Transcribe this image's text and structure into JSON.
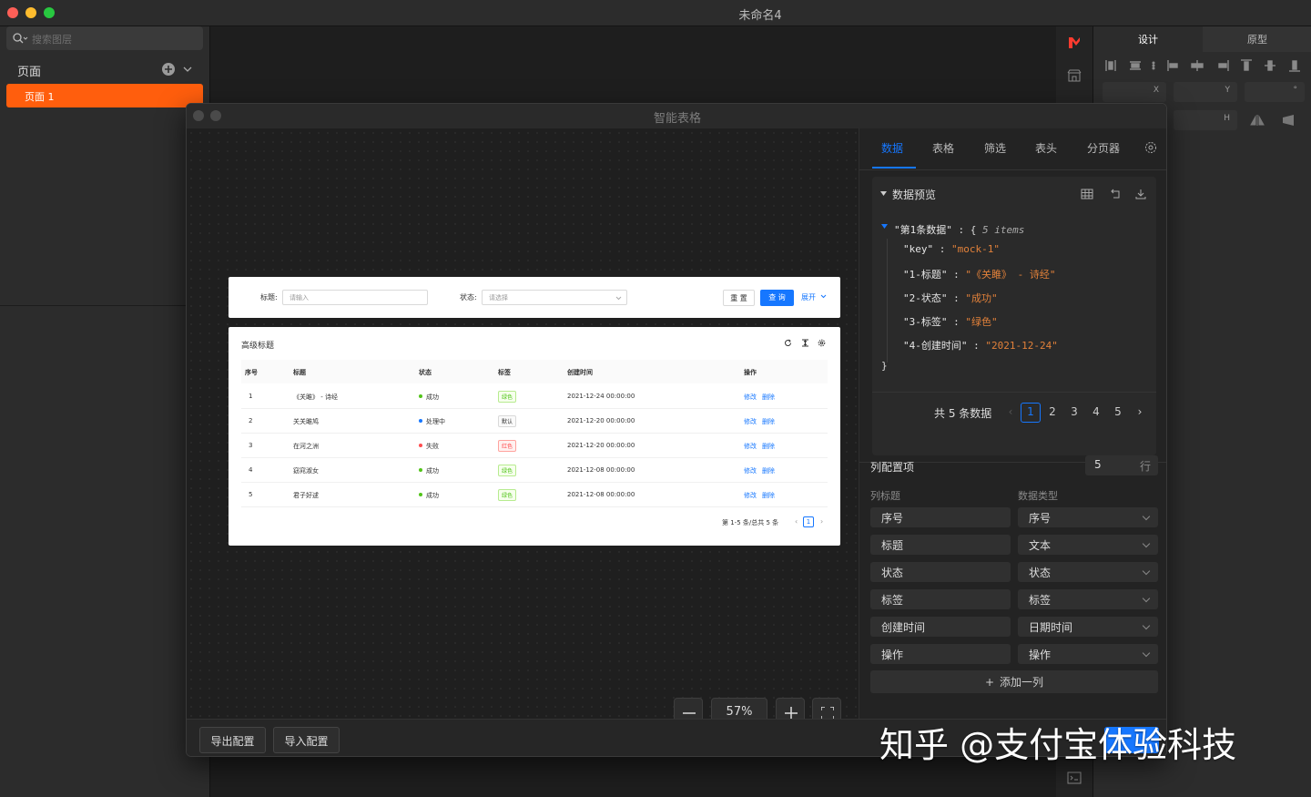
{
  "window": {
    "title": "未命名4"
  },
  "left_panel": {
    "search_placeholder": "搜索图层",
    "pages_label": "页面",
    "pages": [
      "页面 1"
    ]
  },
  "right_panel": {
    "tabs": [
      "设计",
      "原型"
    ],
    "fields": [
      "X",
      "Y",
      "°",
      "H"
    ]
  },
  "modal": {
    "title": "智能表格",
    "zoom": "57%",
    "footer": {
      "export": "导出配置",
      "import": "导入配置"
    }
  },
  "preview": {
    "filter": {
      "title_label": "标题:",
      "title_placeholder": "请输入",
      "status_label": "状态:",
      "status_placeholder": "请选择",
      "reset": "重 置",
      "query": "查 询",
      "expand": "展开"
    },
    "table": {
      "heading": "高级标题",
      "columns": [
        "序号",
        "标题",
        "状态",
        "标签",
        "创建时间",
        "操作"
      ],
      "rows": [
        {
          "no": "1",
          "title": "《关雎》 - 诗经",
          "status": "成功",
          "tag": "绿色",
          "time": "2021-12-24 00:00:00"
        },
        {
          "no": "2",
          "title": "关关雎鸠",
          "status": "处理中",
          "tag": "默认",
          "time": "2021-12-20 00:00:00"
        },
        {
          "no": "3",
          "title": "在河之洲",
          "status": "失败",
          "tag": "红色",
          "time": "2021-12-20 00:00:00"
        },
        {
          "no": "4",
          "title": "窈窕淑女",
          "status": "成功",
          "tag": "绿色",
          "time": "2021-12-08 00:00:00"
        },
        {
          "no": "5",
          "title": "君子好逑",
          "status": "成功",
          "tag": "绿色",
          "time": "2021-12-08 00:00:00"
        }
      ],
      "edit": "修改",
      "delete": "删除",
      "pagination_text": "第 1-5 条/总共 5 条",
      "page": "1"
    }
  },
  "data_panel": {
    "tabs": [
      "数据",
      "表格",
      "筛选",
      "表头",
      "分页器"
    ],
    "preview_title": "数据预览",
    "json": {
      "root_key": "\"第1条数据\"",
      "root_suffix": ": {",
      "items_note": "5 items",
      "lines": [
        {
          "k": "\"key\"",
          "v": "\"mock-1\""
        },
        {
          "k": "\"1-标题\"",
          "v": "\"《关雎》 - 诗经\""
        },
        {
          "k": "\"2-状态\"",
          "v": "\"成功\""
        },
        {
          "k": "\"3-标签\"",
          "v": "\"绿色\""
        },
        {
          "k": "\"4-创建时间\"",
          "v": "\"2021-12-24\""
        }
      ],
      "close": "}"
    },
    "total_text": "共 5 条数据",
    "pages": [
      "1",
      "2",
      "3",
      "4",
      "5"
    ],
    "column_config": {
      "label": "列配置项",
      "row_count": "5",
      "row_unit": "行",
      "col_title_label": "列标题",
      "data_type_label": "数据类型",
      "columns": [
        {
          "title": "序号",
          "type": "序号"
        },
        {
          "title": "标题",
          "type": "文本"
        },
        {
          "title": "状态",
          "type": "状态"
        },
        {
          "title": "标签",
          "type": "标签"
        },
        {
          "title": "创建时间",
          "type": "日期时间"
        },
        {
          "title": "操作",
          "type": "操作"
        }
      ],
      "add_column": "添加一列"
    }
  },
  "watermark": "知乎 @支付宝体验科技",
  "colors": {
    "accent": "#ff5e0d",
    "primary": "#1677ff",
    "json_value": "#e2813a"
  }
}
